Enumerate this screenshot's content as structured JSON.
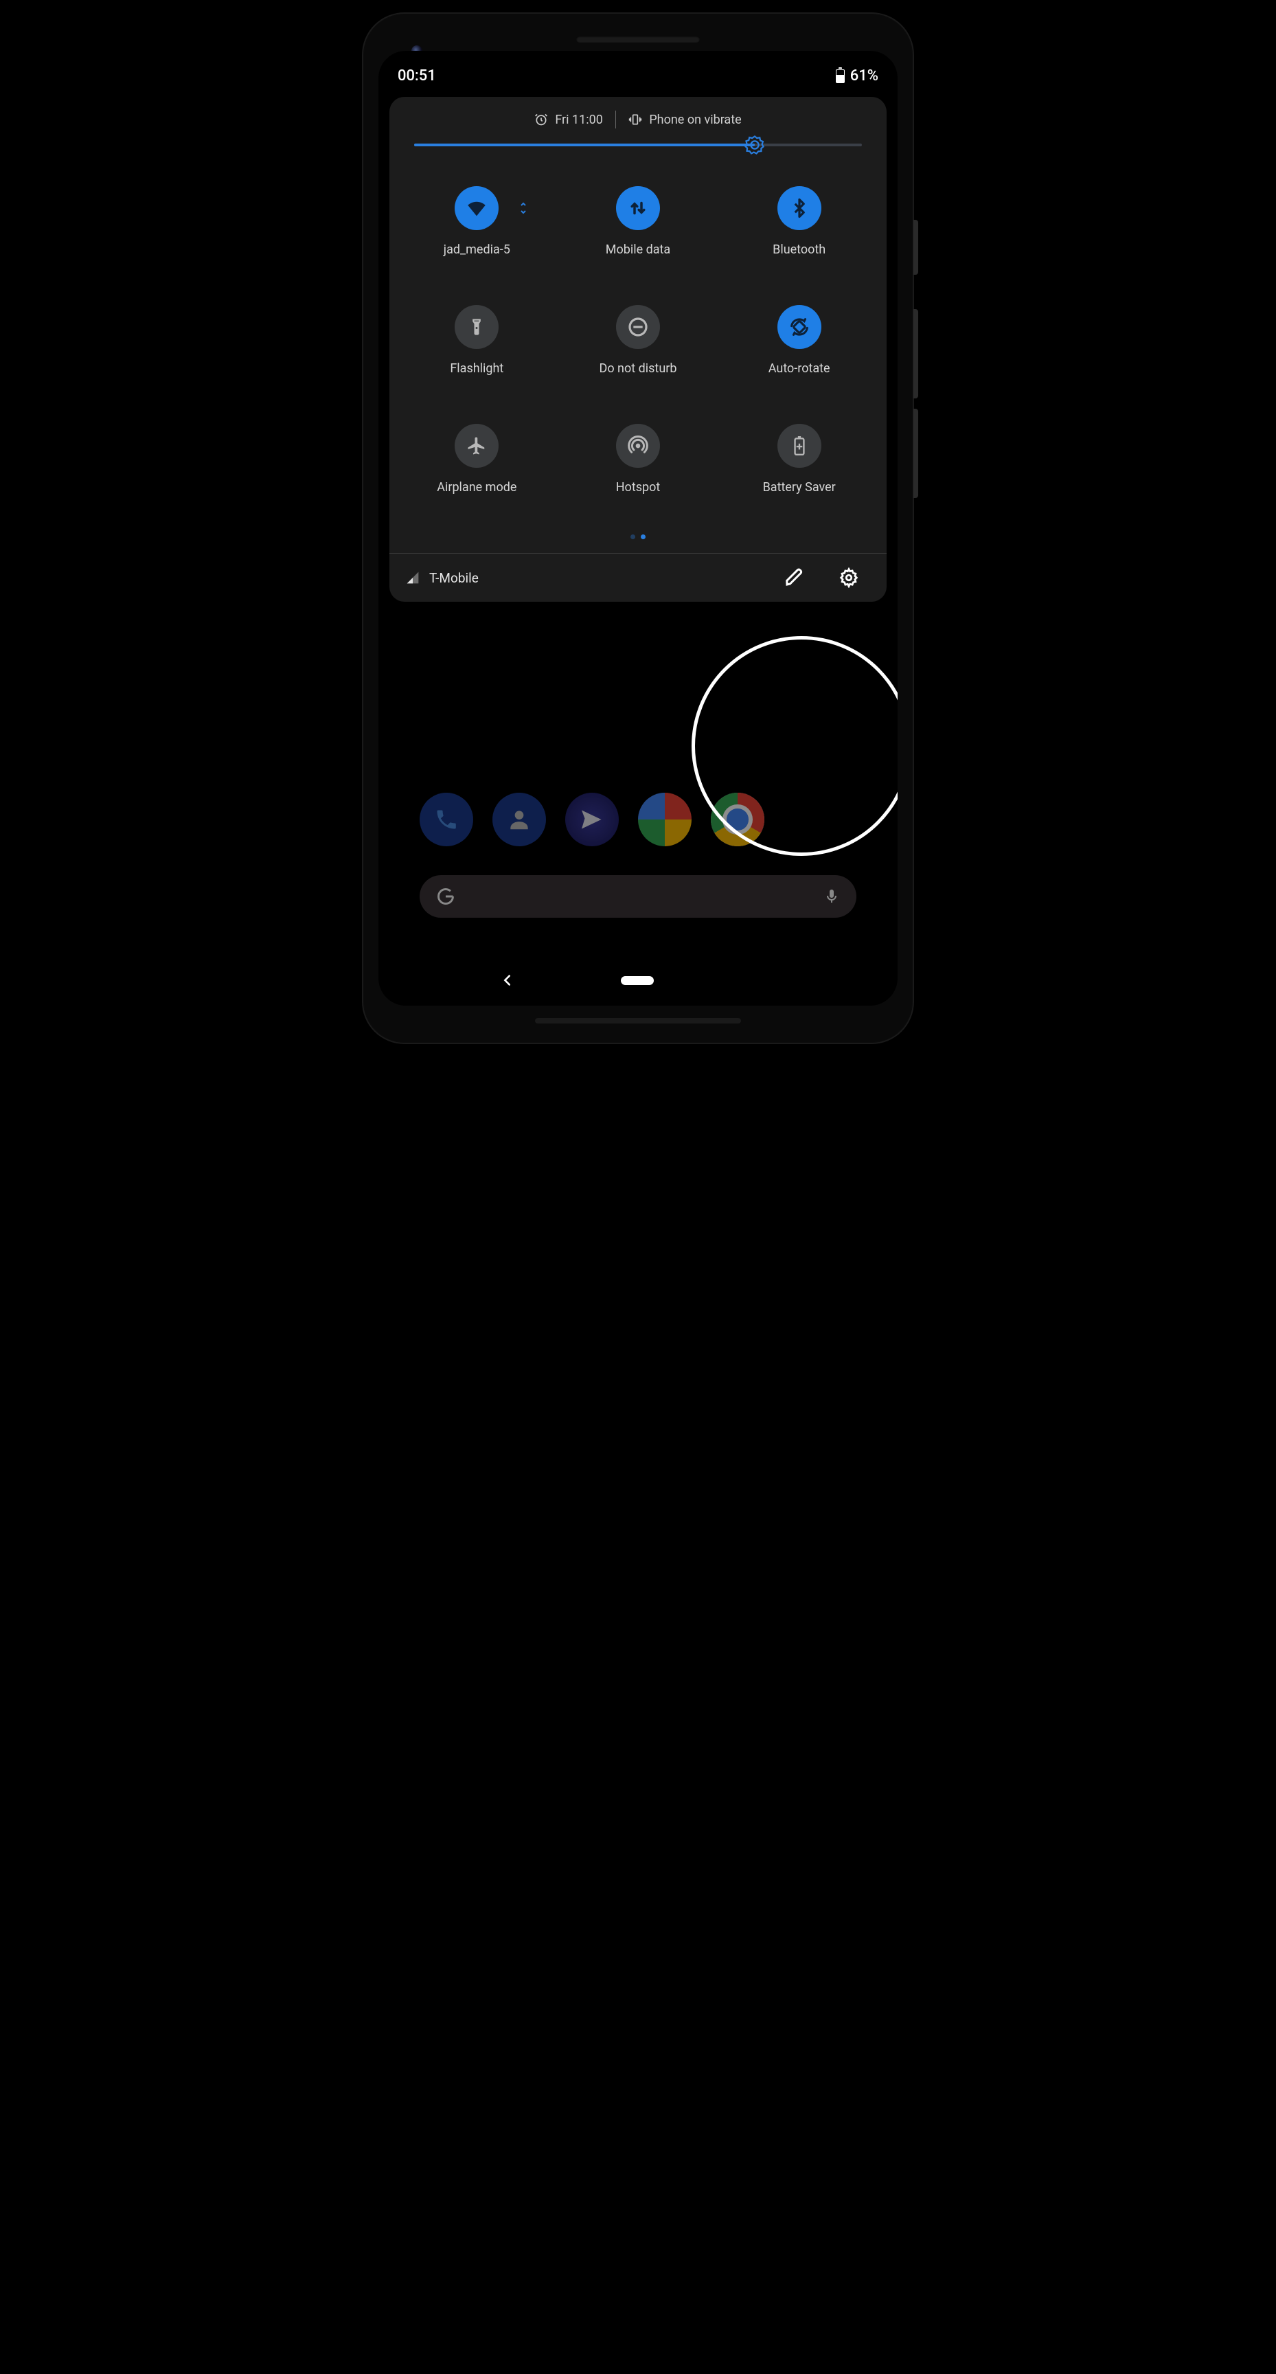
{
  "status": {
    "time": "00:51",
    "battery_pct": "61%"
  },
  "qs_header": {
    "alarm": "Fri 11:00",
    "ringer": "Phone on vibrate"
  },
  "brightness_pct": 76,
  "tiles": [
    {
      "id": "wifi",
      "label": "jad_media-5",
      "active": true
    },
    {
      "id": "mobile-data",
      "label": "Mobile data",
      "active": true
    },
    {
      "id": "bluetooth",
      "label": "Bluetooth",
      "active": true
    },
    {
      "id": "flashlight",
      "label": "Flashlight",
      "active": false
    },
    {
      "id": "dnd",
      "label": "Do not disturb",
      "active": false
    },
    {
      "id": "auto-rotate",
      "label": "Auto-rotate",
      "active": true
    },
    {
      "id": "airplane",
      "label": "Airplane mode",
      "active": false
    },
    {
      "id": "hotspot",
      "label": "Hotspot",
      "active": false
    },
    {
      "id": "battery-saver",
      "label": "Battery Saver",
      "active": false
    }
  ],
  "pager": {
    "pages": 2,
    "current": 1
  },
  "footer": {
    "carrier": "T-Mobile"
  },
  "colors": {
    "accent": "#1f7fe6",
    "panel": "#1c1c1c"
  }
}
